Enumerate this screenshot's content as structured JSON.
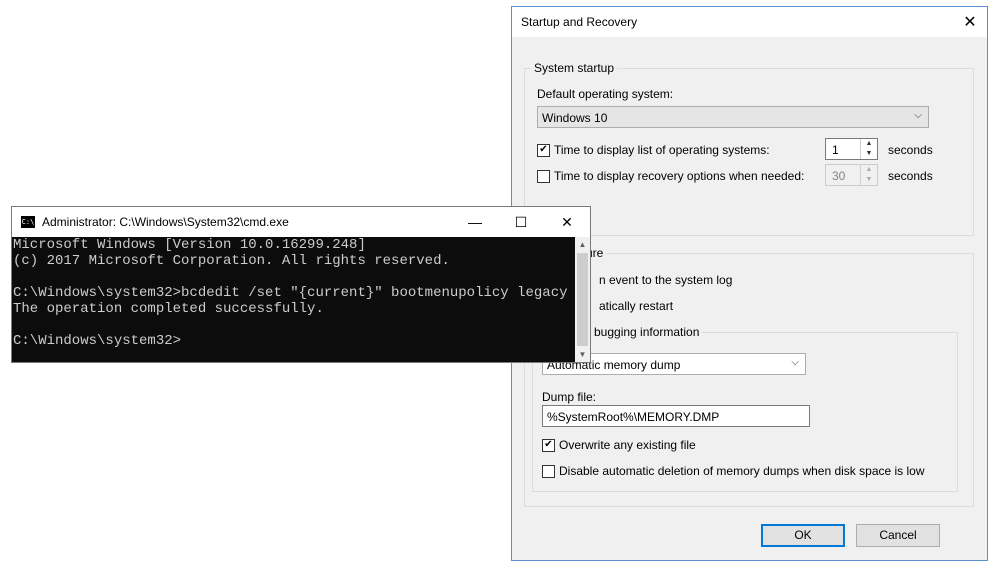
{
  "dialog": {
    "title": "Startup and Recovery",
    "close_glyph": "✕",
    "system_startup": {
      "legend": "System startup",
      "default_os_label": "Default operating system:",
      "default_os_value": "Windows 10",
      "time_list_label": "Time to display list of operating systems:",
      "time_list_checked": true,
      "time_list_value": "1",
      "time_recovery_label": "Time to display recovery options when needed:",
      "time_recovery_checked": false,
      "time_recovery_value": "30",
      "seconds": "seconds"
    },
    "system_failure": {
      "legend_partial": "ure",
      "write_event_partial": "n event to the system log",
      "auto_restart_partial": "atically restart",
      "debug_legend_partial": "bugging information",
      "dump_type_value": "Automatic memory dump",
      "dump_file_label": "Dump file:",
      "dump_file_value": "%SystemRoot%\\MEMORY.DMP",
      "overwrite_label": "Overwrite any existing file",
      "overwrite_checked": true,
      "disable_deletion_label": "Disable automatic deletion of memory dumps when disk space is low",
      "disable_deletion_checked": false
    },
    "ok_label": "OK",
    "cancel_label": "Cancel"
  },
  "cmd": {
    "title": "Administrator: C:\\Windows\\System32\\cmd.exe",
    "icon_text": "C:\\",
    "minimize_glyph": "—",
    "maximize_glyph": "☐",
    "close_glyph": "✕",
    "lines": [
      "Microsoft Windows [Version 10.0.16299.248]",
      "(c) 2017 Microsoft Corporation. All rights reserved.",
      "",
      "C:\\Windows\\system32>bcdedit /set \"{current}\" bootmenupolicy legacy",
      "The operation completed successfully.",
      "",
      "C:\\Windows\\system32>"
    ]
  }
}
